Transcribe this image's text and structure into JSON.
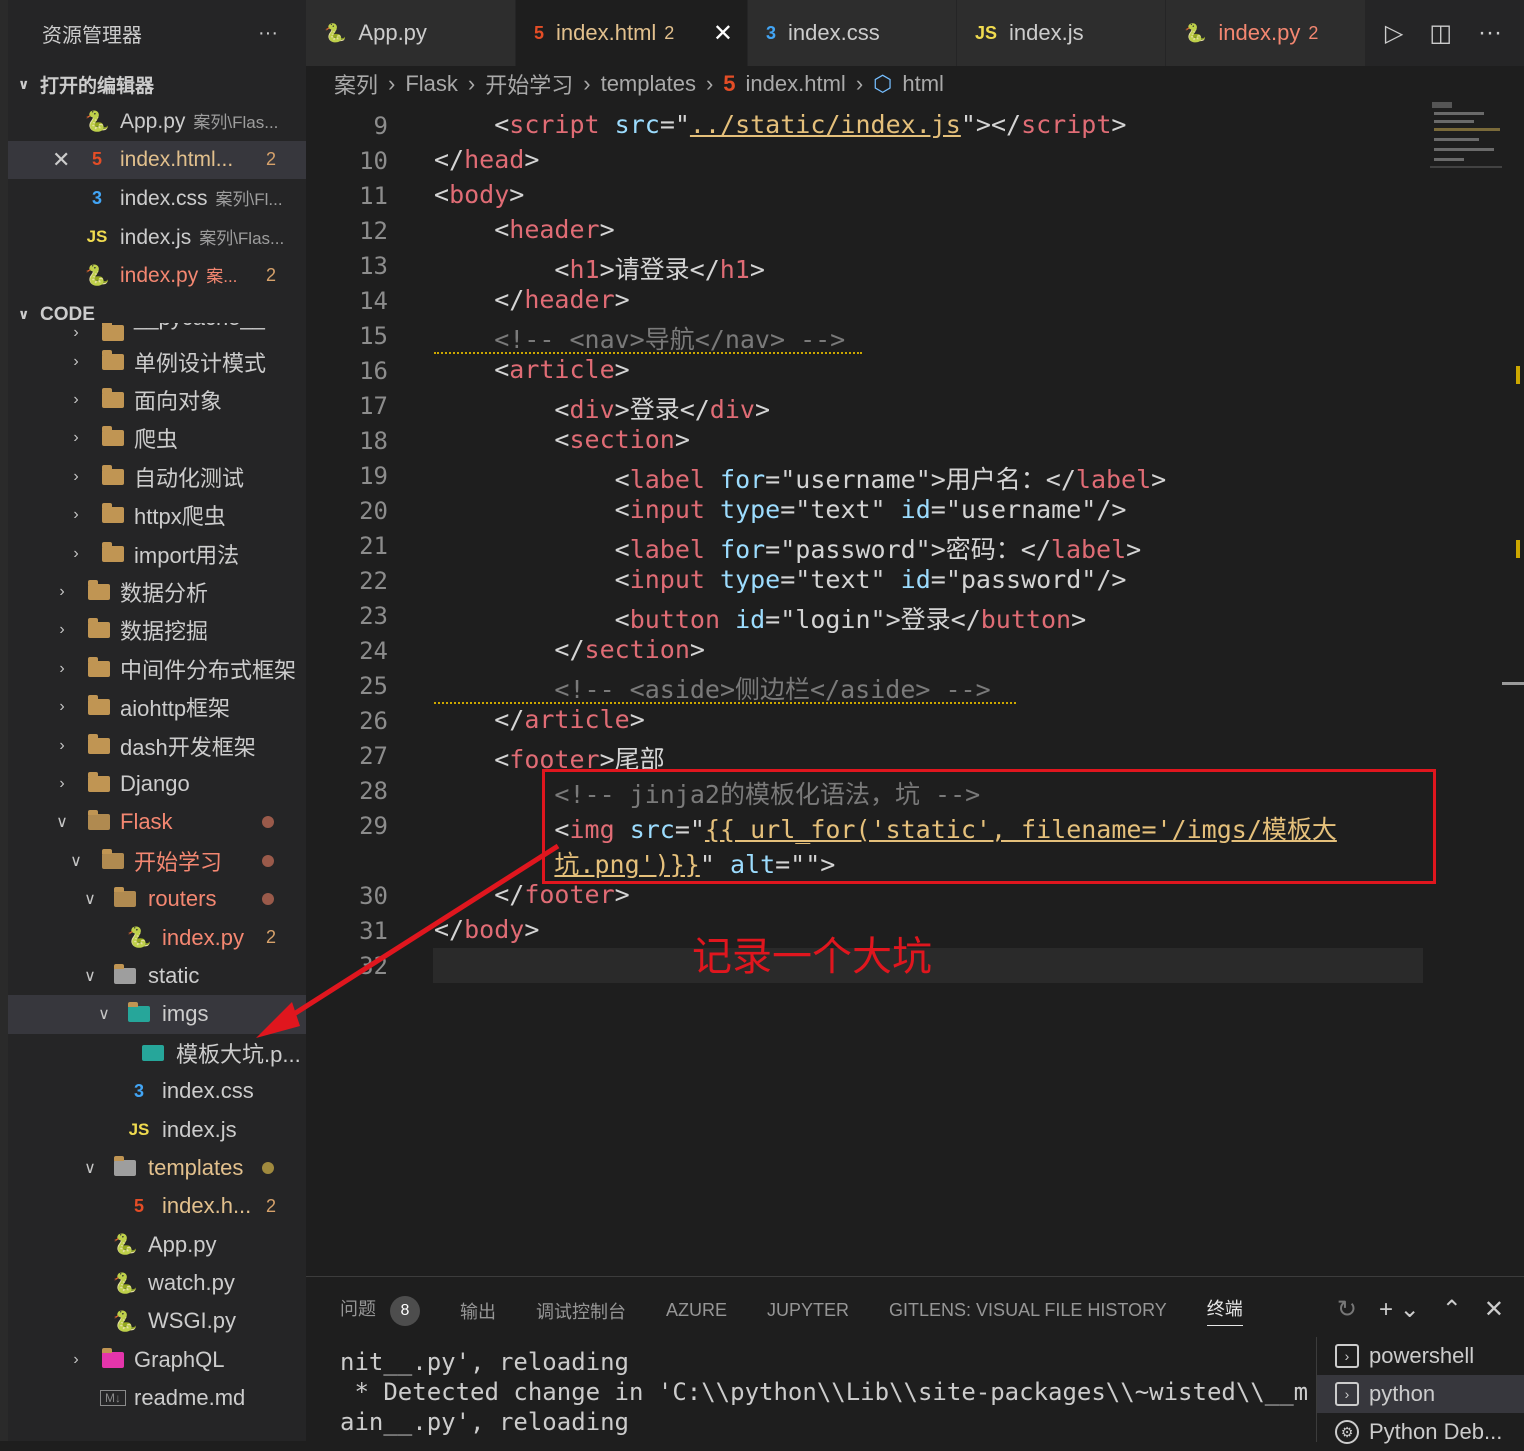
{
  "sidebar": {
    "title": "资源管理器",
    "more": "···",
    "open_editors_title": "打开的编辑器",
    "open_editors": [
      {
        "icon": "python",
        "name": "App.py",
        "desc": "案列\\Flas...",
        "count": ""
      },
      {
        "icon": "html",
        "name": "index.html...",
        "desc": "",
        "count": "2",
        "close": "✕"
      },
      {
        "icon": "css",
        "name": "index.css",
        "desc": "案列\\Fl...",
        "count": ""
      },
      {
        "icon": "js",
        "name": "index.js",
        "desc": "案列\\Flas...",
        "count": ""
      },
      {
        "icon": "python",
        "name": "index.py",
        "desc": "案...",
        "count": "2"
      }
    ],
    "code_title": "CODE",
    "tree": [
      {
        "label": "__pycache__"
      },
      {
        "label": "单例设计模式"
      },
      {
        "label": "面向对象"
      },
      {
        "label": "爬虫"
      },
      {
        "label": "自动化测试"
      },
      {
        "label": "httpx爬虫"
      },
      {
        "label": "import用法"
      },
      {
        "label": "数据分析"
      },
      {
        "label": "数据挖掘"
      },
      {
        "label": "中间件分布式框架"
      },
      {
        "label": "aiohttp框架"
      },
      {
        "label": "dash开发框架"
      },
      {
        "label": "Django"
      },
      {
        "label": "Flask"
      },
      {
        "label": "开始学习"
      },
      {
        "label": "routers"
      },
      {
        "label": "index.py",
        "count": "2"
      },
      {
        "label": "static"
      },
      {
        "label": "imgs"
      },
      {
        "label": "模板大坑.p..."
      },
      {
        "label": "index.css"
      },
      {
        "label": "index.js"
      },
      {
        "label": "templates"
      },
      {
        "label": "index.h...",
        "count": "2"
      },
      {
        "label": "App.py"
      },
      {
        "label": "watch.py"
      },
      {
        "label": "WSGI.py"
      },
      {
        "label": "GraphQL"
      },
      {
        "label": "readme.md"
      }
    ]
  },
  "tabs": [
    {
      "icon": "python",
      "label": "App.py",
      "count": ""
    },
    {
      "icon": "html",
      "label": "index.html",
      "count": "2",
      "close": "✕"
    },
    {
      "icon": "css",
      "label": "index.css",
      "count": ""
    },
    {
      "icon": "js",
      "label": "index.js",
      "count": ""
    },
    {
      "icon": "python",
      "label": "index.py",
      "count": "2"
    }
  ],
  "breadcrumb": [
    "案列",
    "Flask",
    "开始学习",
    "templates",
    "index.html",
    "html"
  ],
  "editor": {
    "line_numbers": [
      "9",
      "10",
      "11",
      "12",
      "13",
      "14",
      "15",
      "16",
      "17",
      "18",
      "19",
      "20",
      "21",
      "22",
      "23",
      "24",
      "25",
      "26",
      "27",
      "28",
      "29",
      "30",
      "31",
      "32"
    ],
    "annotation": "记录一个大坑"
  },
  "panel": {
    "tabs": [
      "问题",
      "输出",
      "调试控制台",
      "AZURE",
      "JUPYTER",
      "GITLENS: VISUAL FILE HISTORY",
      "终端"
    ],
    "problems_count": "8",
    "terminal_lines": [
      "nit__.py', reloading",
      " * Detected change in 'C:\\\\python\\\\Lib\\\\site-packages\\\\~wisted\\\\__m",
      "ain__.py', reloading"
    ],
    "terminals": [
      "powershell",
      "python",
      "Python Deb..."
    ]
  },
  "colors": {
    "accent_red": "#e0161e",
    "modified": "#e2c08d",
    "error": "#f48771"
  }
}
